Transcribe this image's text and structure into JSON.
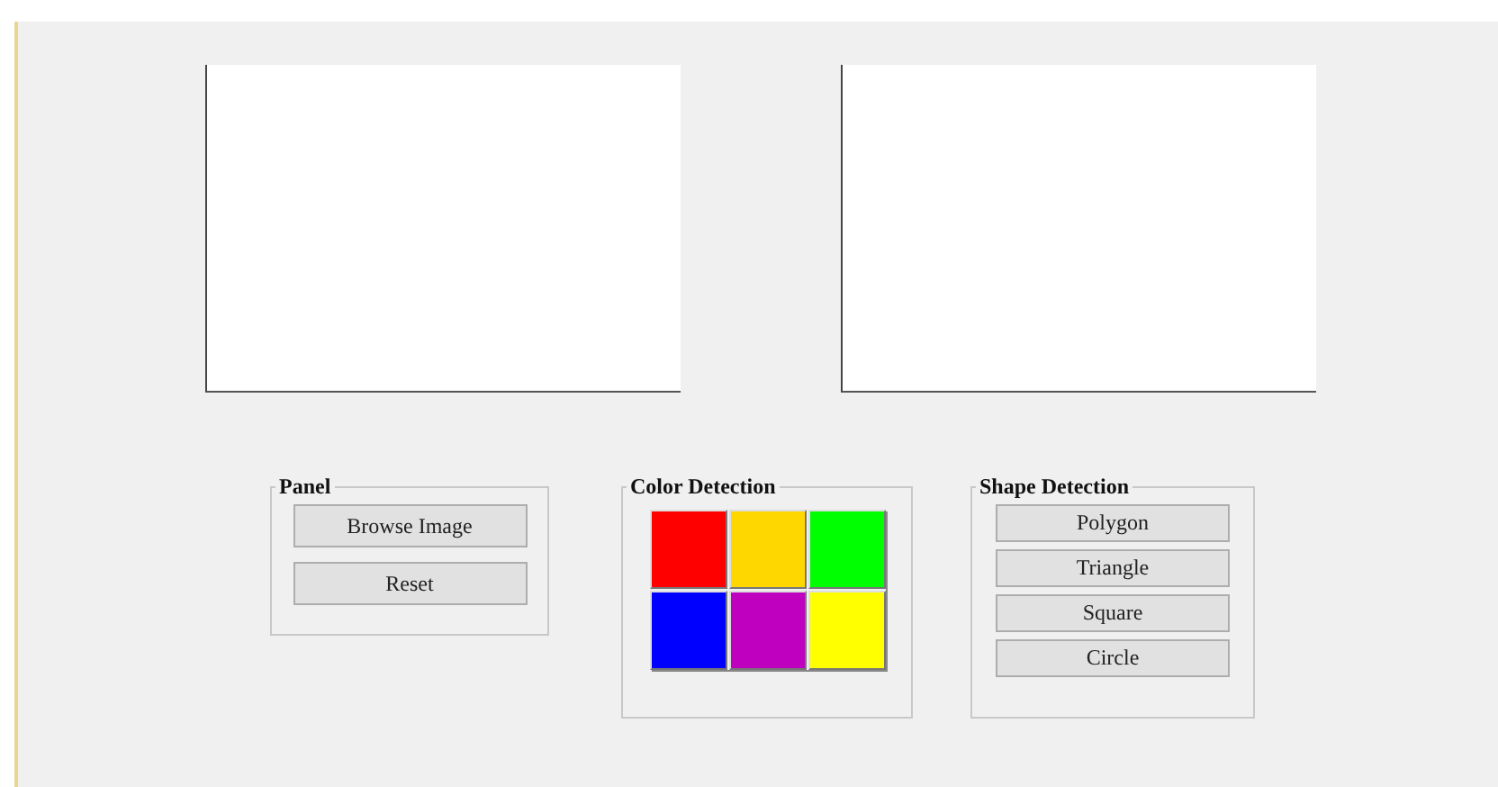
{
  "axes": [
    {
      "kind": "plot"
    },
    {
      "kind": "plot"
    }
  ],
  "panel": {
    "title": "Panel",
    "buttons": [
      "Browse Image",
      "Reset"
    ]
  },
  "color_detection": {
    "title": "Color Detection",
    "swatches": [
      {
        "color": "#ff0000"
      },
      {
        "color": "#ffd700"
      },
      {
        "color": "#00ff00"
      },
      {
        "color": "#0000ff"
      },
      {
        "color": "#bf00bf"
      },
      {
        "color": "#ffff00"
      }
    ]
  },
  "shape_detection": {
    "title": "Shape Detection",
    "buttons": [
      "Polygon",
      "Triangle",
      "Square",
      "Circle"
    ]
  }
}
